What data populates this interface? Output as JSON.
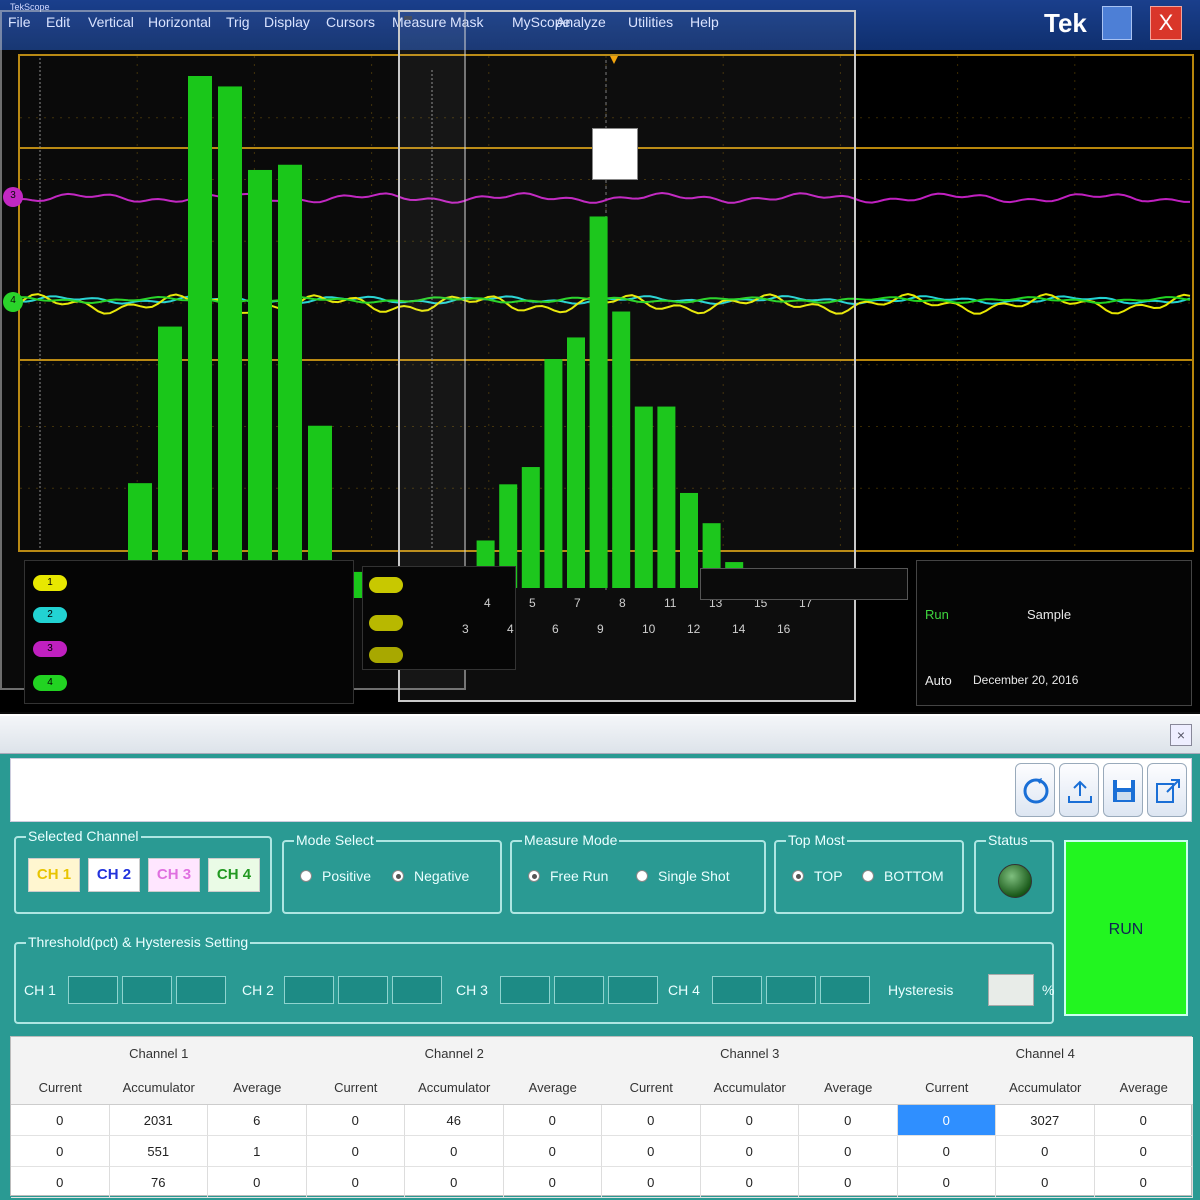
{
  "scope": {
    "software_title": "TekScope",
    "brand": "Tek",
    "menu": [
      "File",
      "Edit",
      "Vertical",
      "Horizontal",
      "Trig",
      "Display",
      "Cursors",
      "Measure",
      "Mask",
      "MyScope",
      "Analyze",
      "Utilities",
      "Help"
    ],
    "zoom_title": "",
    "tooltip_lines": [
      "",
      "",
      ""
    ],
    "channels": [
      {
        "name": "1",
        "scale": "",
        "coupling": "",
        "bw": "",
        "color": "#e8e800"
      },
      {
        "name": "2",
        "scale": "",
        "coupling": "",
        "bw": "",
        "color": "#22d3d3"
      },
      {
        "name": "3",
        "scale": "",
        "coupling": "",
        "bw": "",
        "color": "#c020c0"
      },
      {
        "name": "4",
        "scale": "",
        "coupling": "",
        "bw": "",
        "color": "#22d322"
      }
    ],
    "refs": [
      {
        "label": ""
      },
      {
        "label": ""
      }
    ],
    "x_labels_top": [
      "4",
      "5",
      "7",
      "8",
      "11",
      "13",
      "15",
      "17"
    ],
    "x_labels_bottom": [
      "3",
      "4",
      "6",
      "9",
      "10",
      "12",
      "14",
      "16"
    ],
    "cursor_readout": "",
    "acquisition": {
      "timebase": "",
      "sample_rate": "",
      "record": "",
      "run_state": "Run",
      "mode": "Sample",
      "acqs": "",
      "rl": "",
      "trigger_mode": "Auto",
      "date": "December 20, 2016",
      "time": ""
    },
    "histogram_left": [
      0.22,
      0.52,
      1.0,
      0.98,
      0.82,
      0.83,
      0.33,
      0.05
    ],
    "histogram_right": [
      0.04,
      0.11,
      0.24,
      0.28,
      0.53,
      0.58,
      0.86,
      0.64,
      0.42,
      0.42,
      0.22,
      0.15,
      0.06
    ],
    "colors": {
      "grid": "#b8860b",
      "hist": "#11c511",
      "ch3": "#c020c0",
      "ch1": "#e8e800",
      "ch2": "#22d3d3"
    }
  },
  "app": {
    "title": "",
    "groups": {
      "selected_channel": "Selected Channel",
      "mode_select": "Mode Select",
      "measure_mode": "Measure Mode",
      "top_most": "Top Most",
      "status": "Status",
      "threshold": "Threshold(pct)  & Hysteresis Setting"
    },
    "ch_buttons": [
      {
        "label": "CH 1",
        "color": "#e8c400",
        "bg": "#fff6d0"
      },
      {
        "label": "CH 2",
        "color": "#2233dd",
        "bg": "#ffffff"
      },
      {
        "label": "CH 3",
        "color": "#e070e0",
        "bg": "#ffe6ff"
      },
      {
        "label": "CH 4",
        "color": "#229922",
        "bg": "#eafbe6"
      }
    ],
    "mode": {
      "options": [
        "Positive",
        "Negative"
      ],
      "selected": 1
    },
    "measure": {
      "options": [
        "Free Run",
        "Single Shot"
      ],
      "selected": 0
    },
    "topmost": {
      "options": [
        "TOP",
        "BOTTOM"
      ],
      "selected": 0
    },
    "run_label": "RUN",
    "thresholds": [
      {
        "label": "CH 1",
        "values": [
          "",
          "",
          ""
        ]
      },
      {
        "label": "CH 2",
        "values": [
          "",
          "",
          ""
        ]
      },
      {
        "label": "CH 3",
        "values": [
          "",
          "",
          ""
        ]
      },
      {
        "label": "CH 4",
        "values": [
          "",
          "",
          ""
        ]
      }
    ],
    "hysteresis": {
      "label": "Hysteresis",
      "value": "",
      "unit": "%"
    },
    "table": {
      "groups": [
        "Channel 1",
        "Channel 2",
        "Channel 3",
        "Channel 4"
      ],
      "subheaders": [
        "Current",
        "Accumulator",
        "Average"
      ],
      "rows": [
        [
          "0",
          "2031",
          "6",
          "0",
          "46",
          "0",
          "0",
          "0",
          "0",
          "0",
          "3027",
          "0"
        ],
        [
          "0",
          "551",
          "1",
          "0",
          "0",
          "0",
          "0",
          "0",
          "0",
          "0",
          "0",
          "0"
        ],
        [
          "0",
          "76",
          "0",
          "0",
          "0",
          "0",
          "0",
          "0",
          "0",
          "0",
          "0",
          "0"
        ]
      ]
    }
  }
}
